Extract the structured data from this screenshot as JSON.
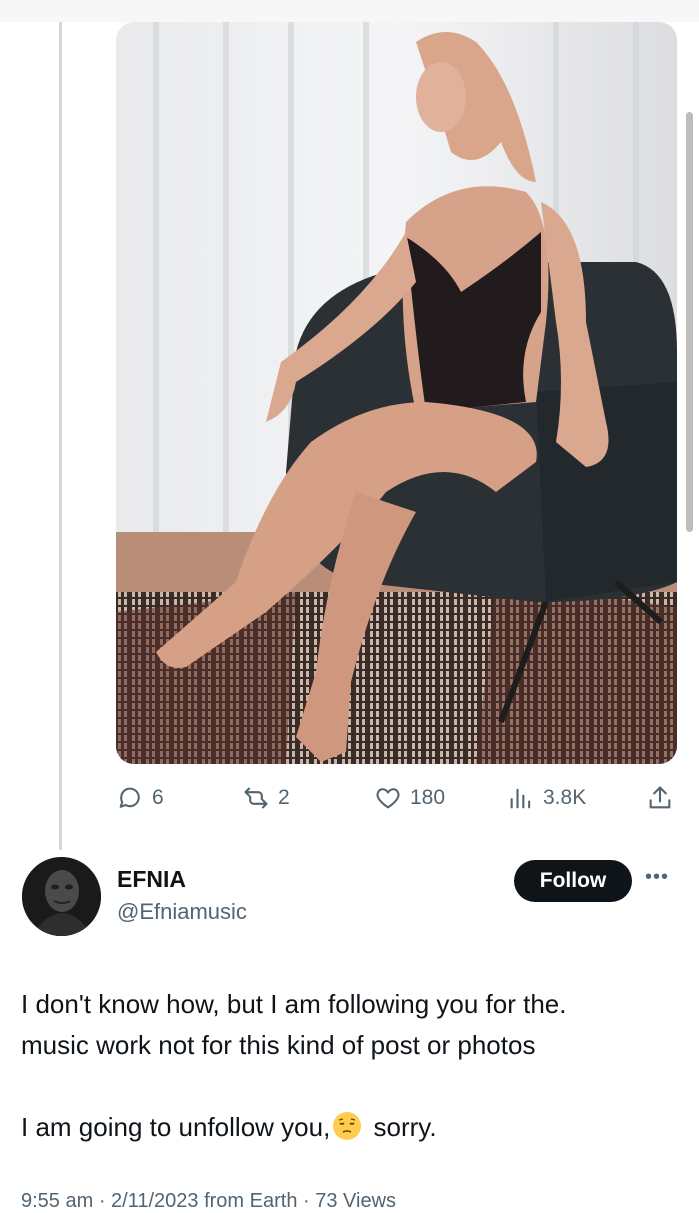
{
  "tweet": {
    "photo": {
      "description_icon": "photo-image"
    },
    "metrics": {
      "replies": "6",
      "reposts": "2",
      "likes": "180",
      "views": "3.8K"
    }
  },
  "reply": {
    "user": {
      "name": "EFNIA",
      "handle": "@Efniamusic",
      "follow_label": "Follow",
      "more_label": "•••"
    },
    "text": {
      "line1": "I don't know how, but I am following you for the.",
      "line2": "music work not for this kind of post or photos",
      "line3_before": "I am going to unfollow you,",
      "line3_after": " sorry."
    },
    "meta_cutoff": "9:55 am · 2/11/2023 from Earth · 73 Views"
  },
  "colors": {
    "text": "#0f1419",
    "secondary": "#536471",
    "thread_line": "#cfd9de",
    "button": "#0f1419"
  }
}
